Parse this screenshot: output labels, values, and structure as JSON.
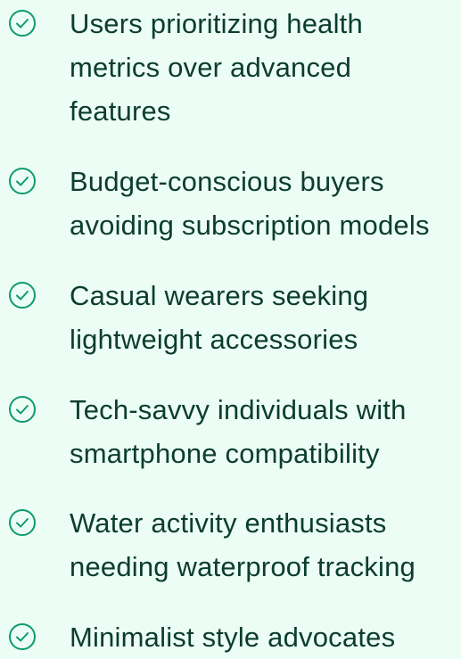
{
  "accent_color": "#0f9b6e",
  "text_color": "#0b3d2e",
  "background_color": "#ecfdf5",
  "items": [
    {
      "icon": "check-circle-icon",
      "text": "Users prioritizing health metrics over advanced features"
    },
    {
      "icon": "check-circle-icon",
      "text": "Budget-conscious buyers avoiding subscription models"
    },
    {
      "icon": "check-circle-icon",
      "text": "Casual wearers seeking lightweight accessories"
    },
    {
      "icon": "check-circle-icon",
      "text": "Tech-savvy individuals with smartphone compatibility"
    },
    {
      "icon": "check-circle-icon",
      "text": "Water activity enthusiasts needing waterproof tracking"
    },
    {
      "icon": "check-circle-icon",
      "text": "Minimalist style advocates"
    }
  ]
}
